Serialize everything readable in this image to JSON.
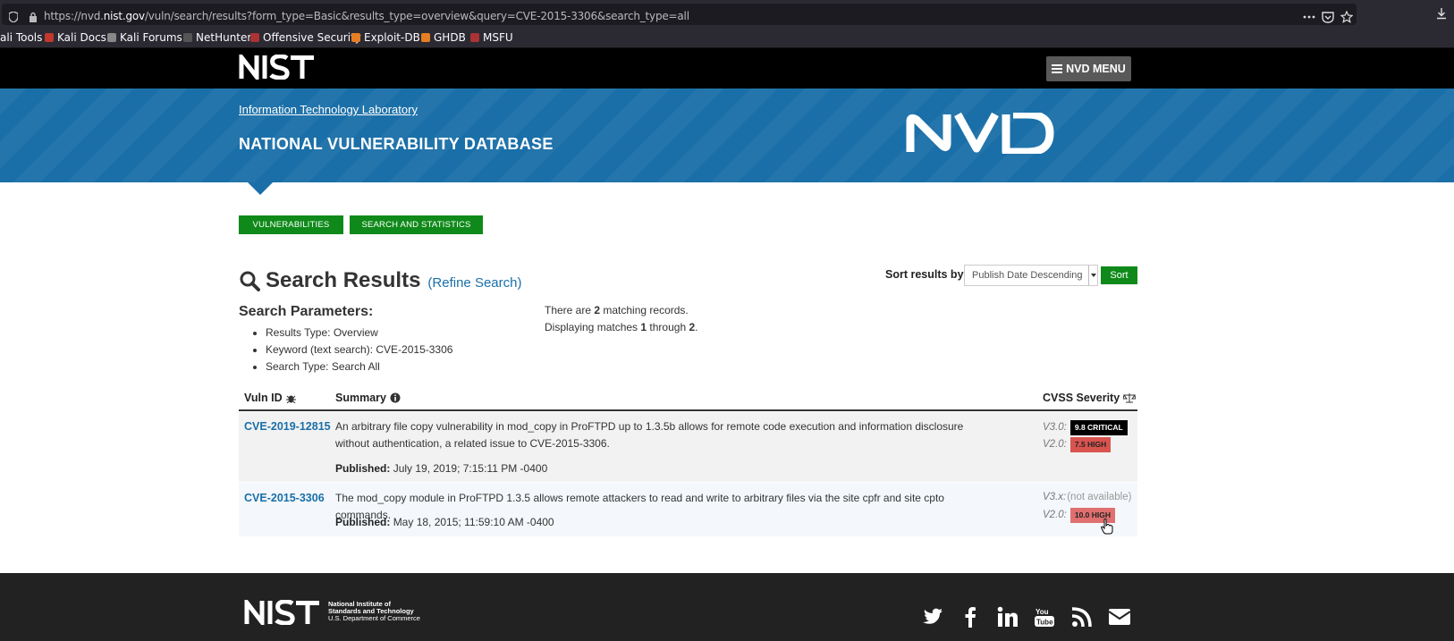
{
  "browser": {
    "url_prefix": "https://nvd.",
    "url_domain": "nist.gov",
    "url_rest": "/vuln/search/results?form_type=Basic&results_type=overview&query=CVE-2015-3306&search_type=all",
    "bookmarks": [
      "ali Tools",
      "Kali Docs",
      "Kali Forums",
      "NetHunter",
      "Offensive Security",
      "Exploit-DB",
      "GHDB",
      "MSFU"
    ]
  },
  "header": {
    "menu_label": "NVD MENU",
    "itl_link": "Information Technology Laboratory",
    "site_title": "NATIONAL VULNERABILITY DATABASE"
  },
  "nav": {
    "vulnerabilities": "VULNERABILITIES",
    "search_stats": "SEARCH AND STATISTICS"
  },
  "search": {
    "title": "Search Results",
    "refine": "(Refine Search)",
    "sort_label": "Sort results by:",
    "sort_value": "Publish Date Descending",
    "sort_button": "Sort",
    "params_title": "Search Parameters:",
    "params": [
      "Results Type: Overview",
      "Keyword (text search): CVE-2015-3306",
      "Search Type: Search All"
    ],
    "matching_pre": "There are ",
    "matching_count": "2",
    "matching_post": " matching records.",
    "display_pre": "Displaying matches ",
    "display_from": "1",
    "display_mid": " through ",
    "display_to": "2",
    "display_post": "."
  },
  "table": {
    "col_vuln": "Vuln ID",
    "col_summary": "Summary",
    "col_cvss": "CVSS Severity",
    "rows": [
      {
        "id": "CVE-2019-12815",
        "summary": "An arbitrary file copy vulnerability in mod_copy in ProFTPD up to 1.3.5b allows for remote code execution and information disclosure without authentication, a related issue to CVE-2015-3306.",
        "published_label": "Published:",
        "published": "July 19, 2019; 7:15:11 PM -0400",
        "v3_label": "V3.0:",
        "v3_badge": "9.8 CRITICAL",
        "v2_label": "V2.0:",
        "v2_badge": "7.5 HIGH"
      },
      {
        "id": "CVE-2015-3306",
        "summary": "The mod_copy module in ProFTPD 1.3.5 allows remote attackers to read and write to arbitrary files via the site cpfr and site cpto commands.",
        "published_label": "Published:",
        "published": "May 18, 2015; 11:59:10 AM -0400",
        "v3_label": "V3.x:",
        "v3_na": "(not available)",
        "v2_label": "V2.0:",
        "v2_badge": "10.0 HIGH"
      }
    ]
  },
  "footer": {
    "org_line1": "National Institute of",
    "org_line2": "Standards and Technology",
    "org_line3": "U.S. Department of Commerce"
  },
  "icons": {
    "social": [
      "twitter-icon",
      "facebook-icon",
      "linkedin-icon",
      "youtube-icon",
      "rss-icon",
      "email-icon"
    ]
  }
}
